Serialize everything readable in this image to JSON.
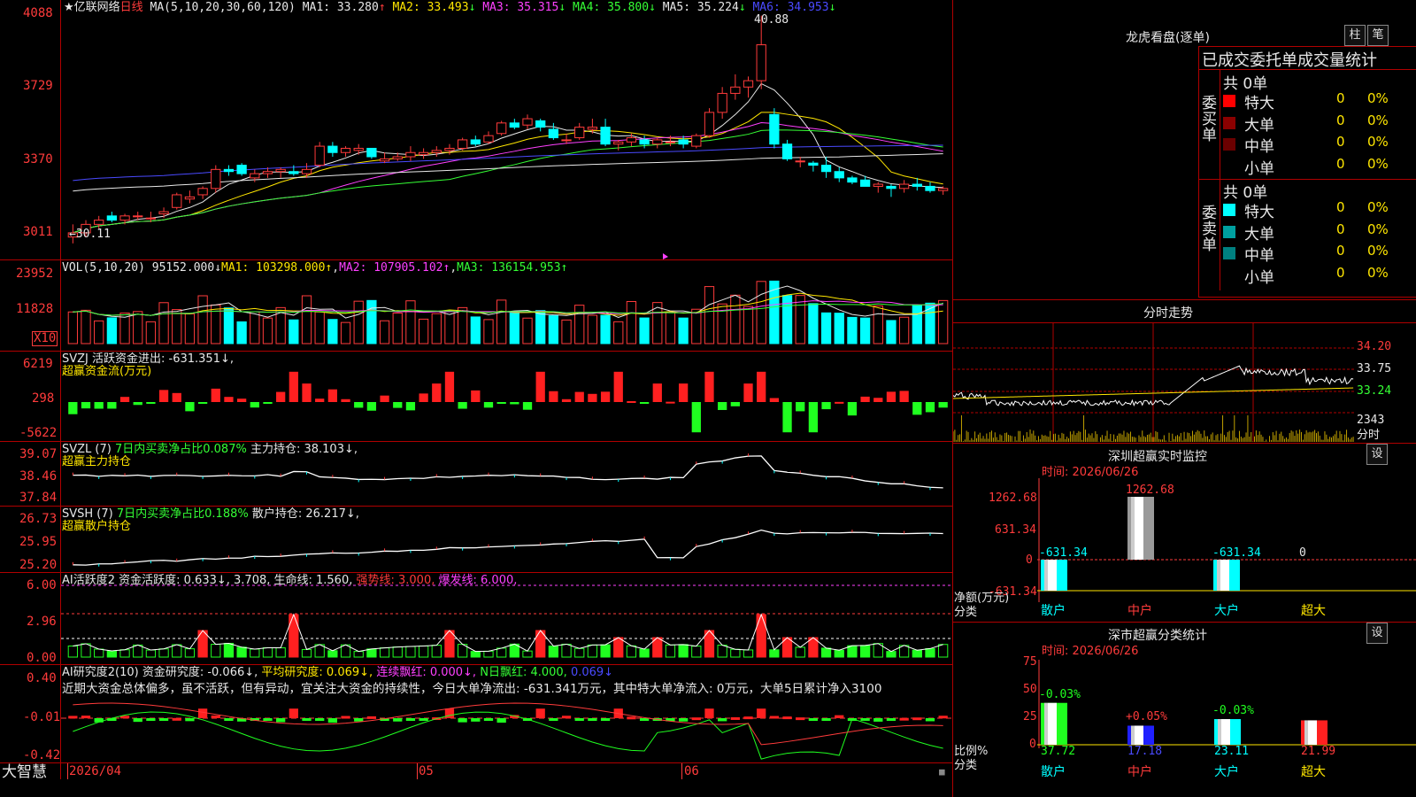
{
  "stock": {
    "name": "亿联网络",
    "period": "日线",
    "ma_header": "MA(5,10,20,30,60,120)"
  },
  "main_panel": {
    "ma_values": [
      {
        "label": "MA1: 33.280",
        "arrow": "↑",
        "color": "#e8e8e8"
      },
      {
        "label": "MA2: 33.493",
        "arrow": "↓",
        "color": "#ffe600"
      },
      {
        "label": "MA3: 35.315",
        "arrow": "↓",
        "color": "#ff40ff"
      },
      {
        "label": "MA4: 35.800",
        "arrow": "↓",
        "color": "#35ff35"
      },
      {
        "label": "MA5: 35.224",
        "arrow": "↓",
        "color": "#e8e8e8"
      },
      {
        "label": "MA6: 34.953",
        "arrow": "↓",
        "color": "#4a4aff"
      }
    ],
    "y_ticks": [
      "4088",
      "3729",
      "3370",
      "3011"
    ],
    "high_label": "40.88",
    "low_label": "←30.11"
  },
  "vol_panel": {
    "header": "VOL(5,10,20)",
    "value": "95152.000↓",
    "ma1": "MA1: 103298.000↑",
    "ma2": "MA2: 107905.102↑",
    "ma3": "MA3: 136154.953↑",
    "y_ticks": [
      "23952",
      "11828"
    ],
    "unit": "X10"
  },
  "svzj_panel": {
    "header": "SVZJ  活跃资金进出: -631.351↓,",
    "sub": "超赢资金流(万元)",
    "y_ticks": [
      "6219",
      "298",
      "-5622"
    ]
  },
  "svzl_panel": {
    "header_a": "SVZL (7)",
    "header_b": "7日内买卖净占比0.087%",
    "header_c": "主力持仓: 38.103↓,",
    "sub": "超赢主力持仓",
    "y_ticks": [
      "39.07",
      "38.46",
      "37.84"
    ]
  },
  "svsh_panel": {
    "header_a": "SVSH (7)",
    "header_b": "7日内买卖净占比0.188%",
    "header_c": "散户持仓: 26.217↓,",
    "sub": "超赢散户持仓",
    "y_ticks": [
      "26.73",
      "25.95",
      "25.20"
    ]
  },
  "ai_panel": {
    "h1": "AI活跃度2 资金活跃度: 0.633↓, 3.708, 生命线: 1.560,",
    "h2": "强势线: 3.000,",
    "h3": "爆发线: 6.000,",
    "y_ticks": [
      "6.00",
      "2.96",
      "0.00"
    ]
  },
  "ai2_panel": {
    "h1": "AI研究度2(10) 资金研究度: -0.066↓,",
    "h2": "平均研究度: 0.069↓,",
    "h3": "连续飘红: 0.000↓,",
    "h4": "N日飘红: 4.000,",
    "h5": "0.069↓",
    "comment": "近期大资金总体偏多，虽不活跃，但有异动，宜关注大资金的持续性，今日大单净流出: -631.341万元，其中特大单净流入: 0万元，大单5日累计净入3100",
    "y_ticks": [
      "0.40",
      "-0.01",
      "-0.42"
    ]
  },
  "bottom": {
    "brand": "大智慧",
    "date": "2026/04",
    "m05": "05",
    "m06": "06"
  },
  "right": {
    "longhu": {
      "title": "龙虎看盘(逐单)",
      "btn1": "柱",
      "btn2": "笔",
      "subtitle": "已成交委托单成交量统计",
      "buy": {
        "side": "委买单",
        "total": "共 0单",
        "rows": [
          {
            "name": "特大",
            "val": "0",
            "pct": "0%",
            "color": "#ff0000"
          },
          {
            "name": "大单",
            "val": "0",
            "pct": "0%",
            "color": "#8b0000"
          },
          {
            "name": "中单",
            "val": "0",
            "pct": "0%",
            "color": "#6b0000"
          },
          {
            "name": "小单",
            "val": "0",
            "pct": "0%",
            "color": ""
          }
        ]
      },
      "sell": {
        "side": "委卖单",
        "total": "共 0单",
        "rows": [
          {
            "name": "特大",
            "val": "0",
            "pct": "0%",
            "color": "#00ffff"
          },
          {
            "name": "大单",
            "val": "0",
            "pct": "0%",
            "color": "#00a0a0"
          },
          {
            "name": "中单",
            "val": "0",
            "pct": "0%",
            "color": "#008080"
          },
          {
            "name": "小单",
            "val": "0",
            "pct": "0%",
            "color": ""
          }
        ]
      }
    },
    "fenshi": {
      "title": "分时走势",
      "ticks": [
        "34.20",
        "33.75",
        "33.24"
      ],
      "vol": "2343",
      "unit": "分时"
    },
    "szmon": {
      "title": "深圳超赢实时监控",
      "btn": "设",
      "time": "时间: 2026/06/26",
      "top": "1262.68",
      "mid": "631.34",
      "zero": "0",
      "neg": "-631.34",
      "left_label": "净额(万元)",
      "left_label2": "分类",
      "bar_labels": [
        "-631.34",
        "1262.68",
        "-631.34",
        "0"
      ],
      "cats": [
        "散户",
        "中户",
        "大户",
        "超大"
      ]
    },
    "szstat": {
      "title": "深市超赢分类统计",
      "btn": "设",
      "time": "时间: 2026/06/26",
      "ticks": [
        "75",
        "50",
        "25",
        "0"
      ],
      "left_label": "比例%",
      "left_label2": "分类",
      "pct_labels": [
        "-0.03%",
        "+0.05%",
        "-0.03%",
        ""
      ],
      "values": [
        "37.72",
        "17.18",
        "23.11",
        "21.99"
      ],
      "cats": [
        "散户",
        "中户",
        "大户",
        "超大"
      ]
    }
  },
  "chart_data": {
    "type": "candlestick",
    "title": "亿联网络 日线",
    "x_labels": [
      "2026/04",
      "05",
      "06"
    ],
    "ylim": [
      30.11,
      40.88
    ],
    "ohlc": [
      [
        30.4,
        31.0,
        30.1,
        30.6
      ],
      [
        30.6,
        31.2,
        30.4,
        31.0
      ],
      [
        31.0,
        31.4,
        30.8,
        31.2
      ],
      [
        31.4,
        31.6,
        31.1,
        31.2
      ],
      [
        31.2,
        31.5,
        31.0,
        31.4
      ],
      [
        31.4,
        31.6,
        31.2,
        31.4
      ],
      [
        31.3,
        31.6,
        31.1,
        31.3
      ],
      [
        31.5,
        31.8,
        31.3,
        31.6
      ],
      [
        31.8,
        32.5,
        31.7,
        32.4
      ],
      [
        32.2,
        32.6,
        32.0,
        32.3
      ],
      [
        32.4,
        32.8,
        32.2,
        32.7
      ],
      [
        32.7,
        33.8,
        32.5,
        33.6
      ],
      [
        33.6,
        33.8,
        33.3,
        33.5
      ],
      [
        33.8,
        33.9,
        33.3,
        33.4
      ],
      [
        33.2,
        33.6,
        33.0,
        33.4
      ],
      [
        33.4,
        33.7,
        33.2,
        33.5
      ],
      [
        33.5,
        33.7,
        33.2,
        33.6
      ],
      [
        33.5,
        33.8,
        33.3,
        33.4
      ],
      [
        33.4,
        33.9,
        33.2,
        33.6
      ],
      [
        33.8,
        34.9,
        33.7,
        34.7
      ],
      [
        34.7,
        34.9,
        34.2,
        34.4
      ],
      [
        34.4,
        34.7,
        34.2,
        34.6
      ],
      [
        34.5,
        34.8,
        34.3,
        34.6
      ],
      [
        34.6,
        34.6,
        34.1,
        34.2
      ],
      [
        34.0,
        34.4,
        33.9,
        34.1
      ],
      [
        34.1,
        34.4,
        34.0,
        34.2
      ],
      [
        34.2,
        34.7,
        34.0,
        34.4
      ],
      [
        34.3,
        34.6,
        34.1,
        34.4
      ],
      [
        34.4,
        34.7,
        34.2,
        34.5
      ],
      [
        34.5,
        34.8,
        34.3,
        34.6
      ],
      [
        34.6,
        35.1,
        34.5,
        35.0
      ],
      [
        35.0,
        35.2,
        34.7,
        34.8
      ],
      [
        34.9,
        35.4,
        34.8,
        35.2
      ],
      [
        35.3,
        35.9,
        35.2,
        35.8
      ],
      [
        35.8,
        36.0,
        35.5,
        35.6
      ],
      [
        35.7,
        36.2,
        35.5,
        36.0
      ],
      [
        35.9,
        36.0,
        35.4,
        35.6
      ],
      [
        35.5,
        35.8,
        35.0,
        35.1
      ],
      [
        35.0,
        35.3,
        34.8,
        35.0
      ],
      [
        35.1,
        35.8,
        35.0,
        35.6
      ],
      [
        35.5,
        36.0,
        35.3,
        35.6
      ],
      [
        35.6,
        36.0,
        34.7,
        34.8
      ],
      [
        34.8,
        35.0,
        34.5,
        34.9
      ],
      [
        34.9,
        35.3,
        34.7,
        35.1
      ],
      [
        35.0,
        35.2,
        34.6,
        34.8
      ],
      [
        34.8,
        35.1,
        34.6,
        35.0
      ],
      [
        34.9,
        35.2,
        34.7,
        34.9
      ],
      [
        35.0,
        35.2,
        34.6,
        34.8
      ],
      [
        34.7,
        35.3,
        34.6,
        35.2
      ],
      [
        35.2,
        36.5,
        35.1,
        36.3
      ],
      [
        36.3,
        37.5,
        36.0,
        37.2
      ],
      [
        37.2,
        38.1,
        36.9,
        37.5
      ],
      [
        37.5,
        38.0,
        37.0,
        37.8
      ],
      [
        37.8,
        40.88,
        37.4,
        39.5
      ],
      [
        36.2,
        36.5,
        34.6,
        34.8
      ],
      [
        34.8,
        35.0,
        34.0,
        34.1
      ],
      [
        34.0,
        34.2,
        33.7,
        34.0
      ],
      [
        33.9,
        34.0,
        33.5,
        33.8
      ],
      [
        33.8,
        34.2,
        33.2,
        33.5
      ],
      [
        33.5,
        33.7,
        33.0,
        33.2
      ],
      [
        33.2,
        33.3,
        32.9,
        33.0
      ],
      [
        33.1,
        33.3,
        32.8,
        32.8
      ],
      [
        32.8,
        33.0,
        32.5,
        32.9
      ],
      [
        32.8,
        32.9,
        32.3,
        32.7
      ],
      [
        32.7,
        33.1,
        32.5,
        32.9
      ],
      [
        32.9,
        33.2,
        32.6,
        32.8
      ],
      [
        32.8,
        33.0,
        32.5,
        32.6
      ],
      [
        32.6,
        32.8,
        32.4,
        32.7
      ]
    ]
  }
}
